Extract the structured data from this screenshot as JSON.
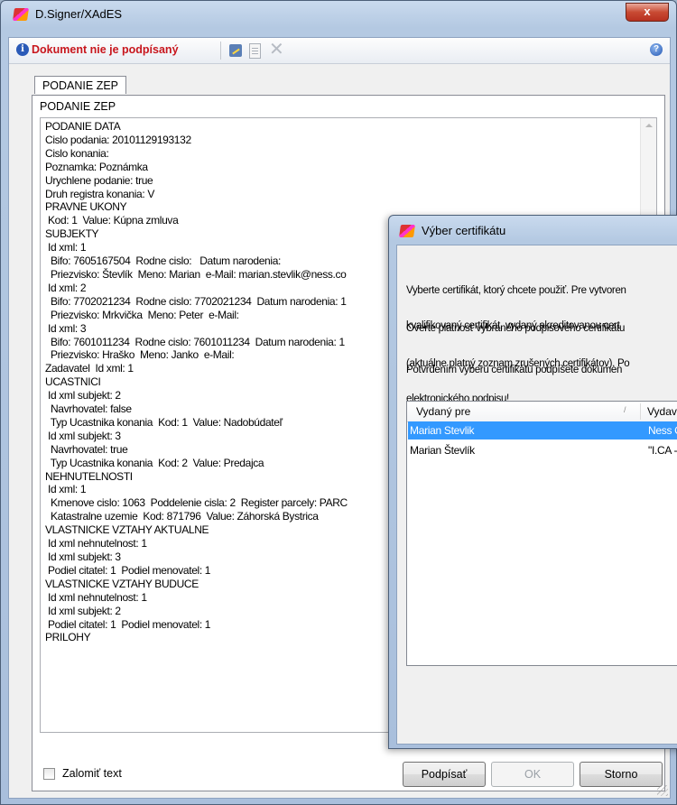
{
  "window": {
    "title": "D.Signer/XAdES",
    "close_label": "x"
  },
  "toolbar": {
    "status": "Dokument nie je podpísaný",
    "info_glyph": "i",
    "help_glyph": "?",
    "delete_glyph": "✕"
  },
  "tab": {
    "label": "PODANIE ZEP"
  },
  "panel": {
    "title": "PODANIE ZEP",
    "lines": [
      "PODANIE DATA",
      "Cislo podania: 20101129193132",
      "Cislo konania:",
      "Poznamka: Poznámka",
      "Urychlene podanie: true",
      "Druh registra konania: V",
      "PRAVNE UKONY",
      " Kod: 1  Value: Kúpna zmluva",
      "SUBJEKTY",
      " Id xml: 1",
      "  Bifo: 7605167504  Rodne cislo:   Datum narodenia:",
      "  Priezvisko: Števlík  Meno: Marian  e-Mail: marian.stevlik@ness.co",
      " Id xml: 2",
      "  Bifo: 7702021234  Rodne cislo: 7702021234  Datum narodenia: 1",
      "  Priezvisko: Mrkvička  Meno: Peter  e-Mail:",
      " Id xml: 3",
      "  Bifo: 7601011234  Rodne cislo: 7601011234  Datum narodenia: 1",
      "  Priezvisko: Hraško  Meno: Janko  e-Mail:",
      "Zadavatel  Id xml: 1",
      "UCASTNICI",
      " Id xml subjekt: 2",
      "  Navrhovatel: false",
      "  Typ Ucastnika konania  Kod: 1  Value: Nadobúdateľ",
      " Id xml subjekt: 3",
      "  Navrhovatel: true",
      "  Typ Ucastnika konania  Kod: 2  Value: Predajca",
      "NEHNUTELNOSTI",
      " Id xml: 1",
      "  Kmenove cislo: 1063  Poddelenie cisla: 2  Register parcely: PARC",
      "  Katastralne uzemie  Kod: 871796  Value: Záhorská Bystrica",
      "VLASTNICKE VZTAHY AKTUALNE",
      " Id xml nehnutelnost: 1",
      " Id xml subjekt: 3",
      " Podiel citatel: 1  Podiel menovatel: 1",
      "VLASTNICKE VZTAHY BUDUCE",
      " Id xml nehnutelnost: 1",
      " Id xml subjekt: 2",
      " Podiel citatel: 1  Podiel menovatel: 1",
      "PRILOHY"
    ],
    "wrap_label": "Zalomiť text"
  },
  "buttons": {
    "sign": "Podpísať",
    "ok": "OK",
    "cancel": "Storno"
  },
  "dialog": {
    "title": "Výber certifikátu",
    "para1": [
      "Vyberte certifikát, ktorý chcete použiť. Pre vytvoren",
      "kvalifikovaný certifikát, vydaný akreditovanou cert"
    ],
    "para2": [
      "Overte platnosť vybraného podpisového certifikátu",
      "(aktuálne platný zoznam zrušených certifikátov). Po",
      "elektronického podpisu!"
    ],
    "para3": "Potvrdením výberu certifikátu podpíšete dokumen",
    "columns": [
      "Vydaný pre",
      "Vydav"
    ],
    "sort_glyph": "/",
    "rows": [
      {
        "issued_to": "Marian Stevlik",
        "issuer": "Ness C",
        "selected": true
      },
      {
        "issued_to": "Marian Števlík",
        "issuer": "\"I.CA -",
        "selected": false
      }
    ]
  }
}
